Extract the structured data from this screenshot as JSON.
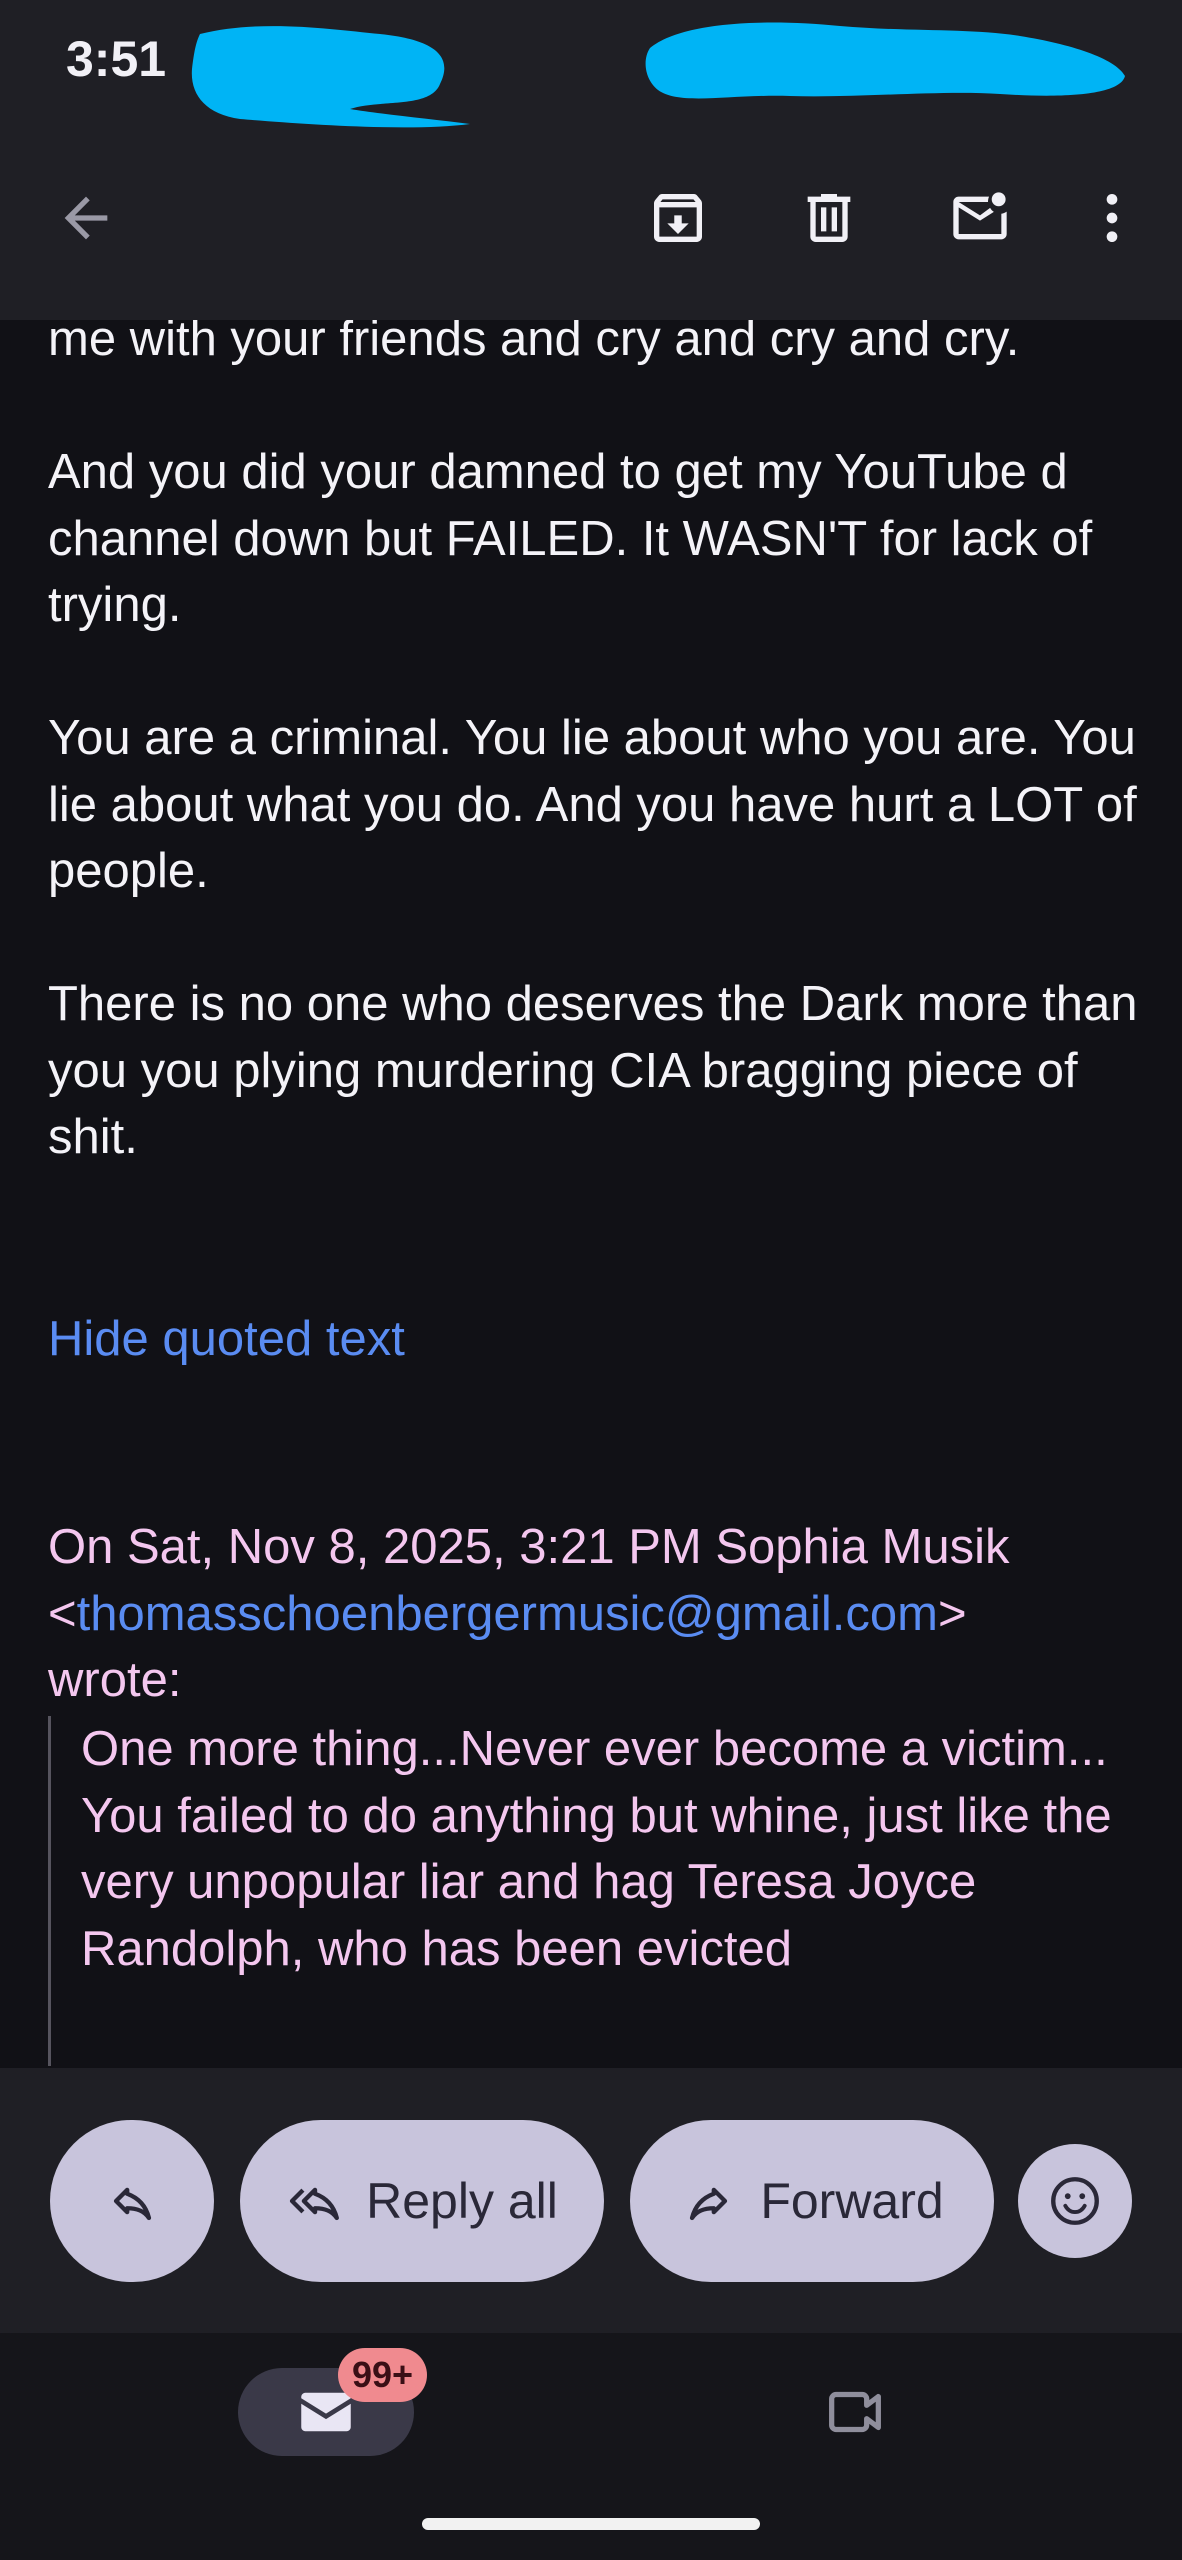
{
  "status_bar": {
    "time": "3:51"
  },
  "toolbar": {
    "back_icon": "arrow-back-icon",
    "archive_icon": "archive-icon",
    "delete_icon": "delete-icon",
    "mark_unread_icon": "mark-unread-icon",
    "more_icon": "more-vert-icon"
  },
  "message": {
    "paragraphs": [
      "me with your friends and cry and cry and cry.",
      "And you did your damned to get my YouTube d channel down but FAILED. It WASN'T for lack of trying.",
      "You are a criminal. You lie about who you are. You lie about what you do. And you have hurt a LOT of people.",
      "There is no one who deserves the Dark more than you you plying murdering CIA bragging piece of shit."
    ],
    "hide_quoted_label": "Hide quoted text",
    "quote_header": {
      "prefix": "On Sat, Nov 8, 2025, 3:21 PM Sophia Musik <",
      "email": "thomasschoenbergermusic@gmail.com",
      "suffix": ">",
      "wrote": "wrote:"
    },
    "quote_lines": [
      "One more thing...Never ever become a victim...",
      "You failed to do anything but whine, just like the very unpopular liar and hag Teresa Joyce Randolph, who has been evicted"
    ]
  },
  "actions": {
    "reply_icon": "reply-icon",
    "reply_all_label": "Reply all",
    "forward_label": "Forward",
    "emoji_icon": "emoji-icon"
  },
  "bottom_nav": {
    "mail_badge": "99+",
    "mail_icon": "mail-icon",
    "meet_icon": "video-icon"
  },
  "colors": {
    "background": "#111116",
    "chrome": "#1f1f25",
    "link": "#5a8cf2",
    "quoted_text": "#f4c7ef",
    "pill": "#c8c4dc",
    "badge": "#f08a8f",
    "redaction": "#00b4f5"
  }
}
